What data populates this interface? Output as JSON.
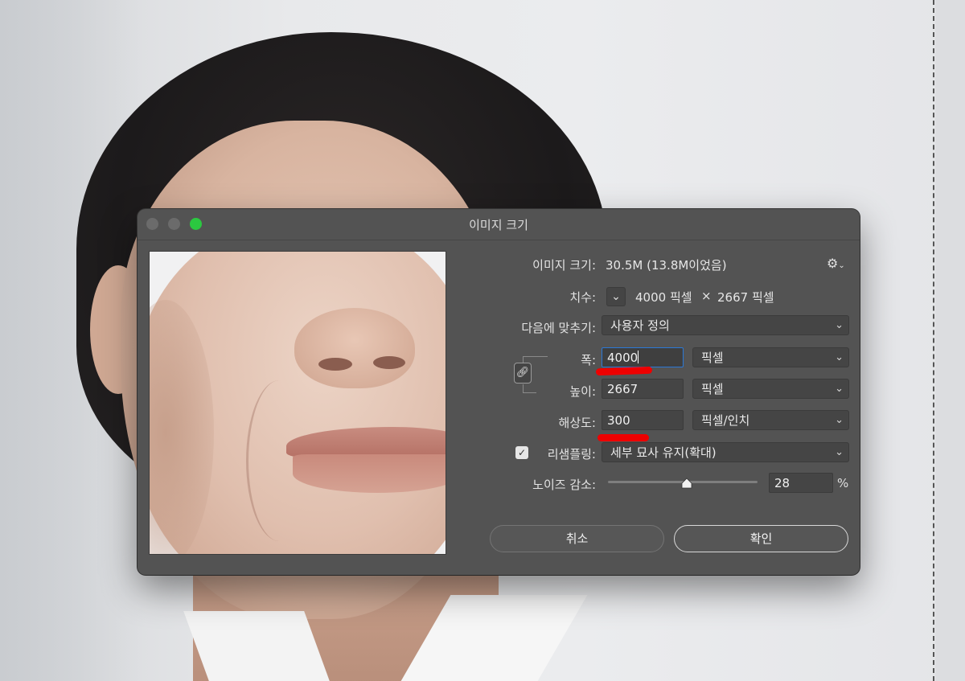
{
  "dialog": {
    "title": "이미지 크기",
    "image_size_label": "이미지 크기:",
    "image_size_value": "30.5M (13.8M이었음)",
    "dimensions_label": "치수:",
    "dimensions_width": "4000 픽셀",
    "dimensions_times": "×",
    "dimensions_height": "2667 픽셀",
    "fit_to_label": "다음에 맞추기:",
    "fit_to_value": "사용자 정의",
    "width_label": "폭:",
    "width_value": "4000",
    "width_unit": "픽셀",
    "height_label": "높이:",
    "height_value": "2667",
    "height_unit": "픽셀",
    "resolution_label": "해상도:",
    "resolution_value": "300",
    "resolution_unit": "픽셀/인치",
    "resample_label": "리샘플링:",
    "resample_checked": true,
    "resample_value": "세부 묘사 유지(확대)",
    "noise_label": "노이즈 감소:",
    "noise_value": "28",
    "noise_unit": "%",
    "cancel_label": "취소",
    "ok_label": "확인"
  },
  "colors": {
    "dialog_bg": "#535353",
    "accent_field_border": "#2b78d6",
    "annotation_red": "#ee0000",
    "zoom_button_green": "#2bc840"
  },
  "icons": {
    "gear": "gear-icon",
    "chain": "link-icon",
    "chevron": "chevron-down-icon",
    "check": "checkmark-icon"
  }
}
